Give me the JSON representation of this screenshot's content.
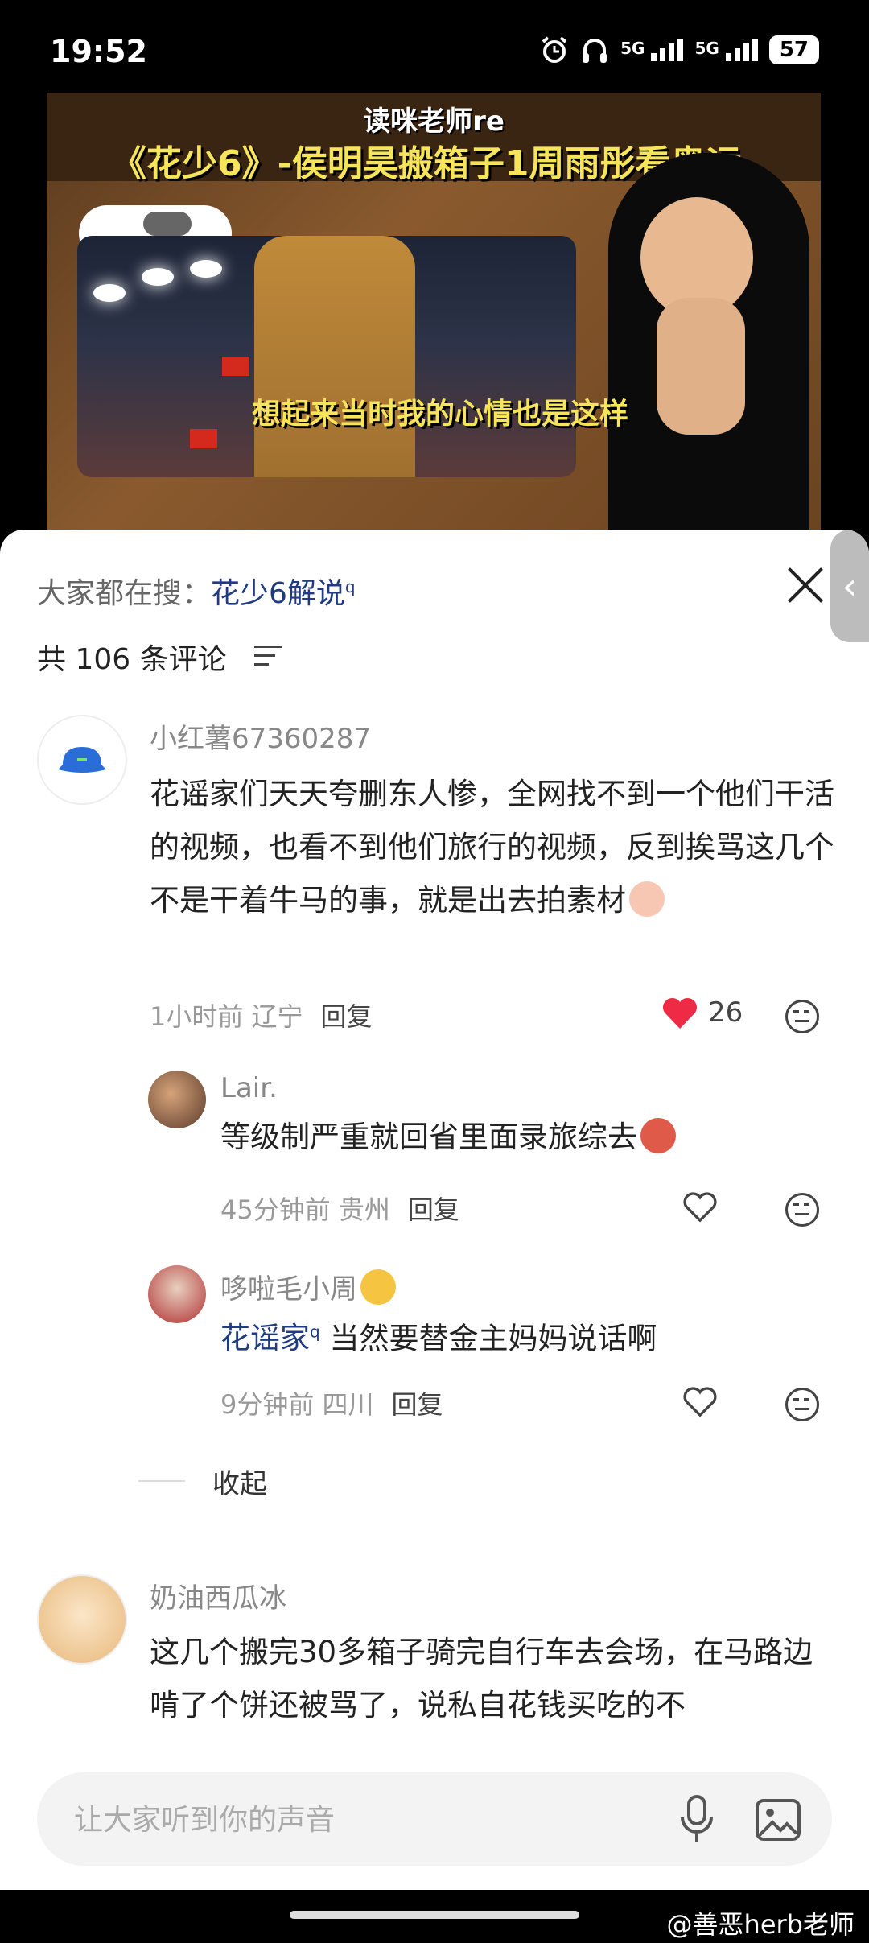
{
  "status_bar": {
    "time": "19:52",
    "network_1": "5G",
    "network_2": "5G",
    "battery": "57"
  },
  "video": {
    "author_tag": "读咪老师re",
    "title": "《花少6》-侯明昊搬箱子1周雨彤看奥运",
    "caption": "想起来当时我的心情也是这样"
  },
  "comments_panel": {
    "search_prefix": "大家都在搜：",
    "search_term": "花少6解说",
    "comment_count": "共 106 条评论",
    "collapse_label": "收起"
  },
  "comments": [
    {
      "user": "小红薯67360287",
      "text": "花谣家们天天夸删东人惨，全网找不到一个他们干活的视频，也看不到他们旅行的视频，反到挨骂这几个不是干着牛马的事，就是出去拍素材",
      "time_location": "1小时前 辽宁",
      "reply_label": "回复",
      "likes": "26",
      "liked": true,
      "replies": [
        {
          "user": "Lair.",
          "text": "等级制严重就回省里面录旅综去",
          "time_location": "45分钟前 贵州",
          "reply_label": "回复"
        },
        {
          "user": "哆啦毛小周",
          "topic": "花谣家",
          "text": "当然要替金主妈妈说话啊",
          "time_location": "9分钟前 四川",
          "reply_label": "回复"
        }
      ]
    },
    {
      "user": "奶油西瓜冰",
      "text": "这几个搬完30多箱子骑完自行车去会场，在马路边啃了个饼还被骂了，说私自花钱买吃的不"
    }
  ],
  "input": {
    "placeholder": "让大家听到你的声音"
  },
  "watermark": "@善恶herb老师",
  "colors": {
    "accent_red": "#ee2a44",
    "topic_blue": "#1f3b82"
  }
}
